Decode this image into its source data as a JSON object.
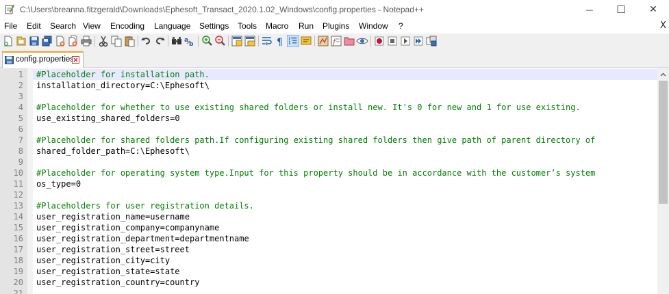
{
  "window": {
    "title": "C:\\Users\\breanna.fitzgerald\\Downloads\\Ephesoft_Transact_2020.1.02_Windows\\config.properties - Notepad++",
    "minimize_label": "—",
    "maximize_label": "☐",
    "close_label": "✕"
  },
  "menu": {
    "items": [
      "File",
      "Edit",
      "Search",
      "View",
      "Encoding",
      "Language",
      "Settings",
      "Tools",
      "Macro",
      "Run",
      "Plugins",
      "Window",
      "?"
    ],
    "close_doc_label": "X"
  },
  "toolbar": {
    "icons": [
      "new-file-icon",
      "open-file-icon",
      "save-icon",
      "save-all-icon",
      "close-icon",
      "close-all-icon",
      "print-icon",
      "cut-icon",
      "copy-icon",
      "paste-icon",
      "undo-icon",
      "redo-icon",
      "find-icon",
      "replace-icon",
      "zoom-in-icon",
      "zoom-out-icon",
      "sync-vertical-icon",
      "sync-horizontal-icon",
      "word-wrap-icon",
      "all-characters-icon",
      "indent-guide-icon",
      "language-icon",
      "document-map-icon",
      "function-list-icon",
      "folder-workspace-icon",
      "monitoring-icon",
      "record-macro-icon",
      "stop-record-icon",
      "play-macro-icon",
      "run-macro-multiple-icon",
      "save-macro-icon"
    ],
    "active_icon": "indent-guide-icon"
  },
  "tab": {
    "label": "config.properties",
    "accent_color": "#f0a32e"
  },
  "editor": {
    "comment_color": "#008000",
    "current_line_color": "#e8e8ff",
    "lines": [
      {
        "n": "1",
        "type": "comment",
        "text": "#Placeholder for installation path."
      },
      {
        "n": "2",
        "type": "kv",
        "key": "installation_directory",
        "op": "=",
        "value": "C:\\Ephesoft\\"
      },
      {
        "n": "3",
        "type": "blank",
        "text": ""
      },
      {
        "n": "4",
        "type": "comment",
        "text": "#Placeholder for whether to use existing shared folders or install new. It's 0 for new and 1 for use existing."
      },
      {
        "n": "5",
        "type": "kv",
        "key": "use_existing_shared_folders",
        "op": "=",
        "value": "0"
      },
      {
        "n": "6",
        "type": "blank",
        "text": ""
      },
      {
        "n": "7",
        "type": "comment",
        "text": "#Placeholder for shared folders path.If configuring existing shared folders then give path of parent directory of"
      },
      {
        "n": "8",
        "type": "kv",
        "key": "shared_folder_path",
        "op": "=",
        "value": "C:\\Ephesoft\\"
      },
      {
        "n": "9",
        "type": "blank",
        "text": ""
      },
      {
        "n": "10",
        "type": "comment",
        "text": "#Placeholder for operating system type.Input for this property should be in accordance with the customer’s system"
      },
      {
        "n": "11",
        "type": "kv",
        "key": "os_type",
        "op": "=",
        "value": "0"
      },
      {
        "n": "12",
        "type": "blank",
        "text": ""
      },
      {
        "n": "13",
        "type": "comment",
        "text": "#Placeholders for user registration details."
      },
      {
        "n": "14",
        "type": "kv",
        "key": "user_registration_name",
        "op": "=",
        "value": "username"
      },
      {
        "n": "15",
        "type": "kv",
        "key": "user_registration_company",
        "op": "=",
        "value": "companyname"
      },
      {
        "n": "16",
        "type": "kv",
        "key": "user_registration_department",
        "op": "=",
        "value": "departmentname"
      },
      {
        "n": "17",
        "type": "kv",
        "key": "user_registration_street",
        "op": "=",
        "value": "street"
      },
      {
        "n": "18",
        "type": "kv",
        "key": "user_registration_city",
        "op": "=",
        "value": "city"
      },
      {
        "n": "19",
        "type": "kv",
        "key": "user_registration_state",
        "op": "=",
        "value": "state"
      },
      {
        "n": "20",
        "type": "kv",
        "key": "user_registration_country",
        "op": "=",
        "value": "country"
      },
      {
        "n": "21",
        "type": "blank",
        "text": ""
      }
    ]
  }
}
